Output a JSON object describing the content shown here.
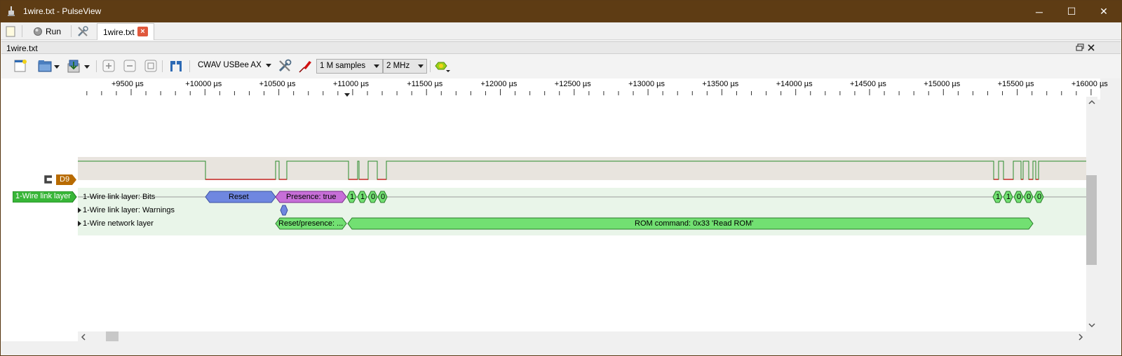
{
  "window": {
    "title": "1wire.txt - PulseView",
    "controls": [
      "─",
      "☐",
      "✕"
    ]
  },
  "tabs": {
    "new_icon": "document-icon",
    "run_label": "Run",
    "doc_tab_label": "1wire.txt",
    "close_glyph": "×"
  },
  "doc_bar": {
    "title": "1wire.txt"
  },
  "toolbar": {
    "device": "CWAV USBee AX",
    "samples": "1 M samples",
    "rate": "2 MHz"
  },
  "ruler": {
    "ticks": [
      "+9500 µs",
      "+10000 µs",
      "+10500 µs",
      "+11000 µs",
      "+11500 µs",
      "+12000 µs",
      "+12500 µs",
      "+13000 µs",
      "+13500 µs",
      "+14000 µs",
      "+14500 µs",
      "+15000 µs",
      "+15500 µs",
      "+16000 µs"
    ]
  },
  "channel": {
    "name": "D9"
  },
  "decoder": {
    "name": "1-Wire link layer",
    "rows": [
      "1-Wire link layer: Bits",
      "1-Wire link layer: Warnings",
      "1-Wire network layer"
    ],
    "annotations": {
      "reset": "Reset",
      "presence": "Presence: true",
      "bits_left": [
        "1",
        "1",
        "0",
        "0"
      ],
      "bits_right": [
        "1",
        "1",
        "0",
        "0",
        "0"
      ],
      "reset_presence": "Reset/presence: ...",
      "rom_command": "ROM command: 0x33 'Read ROM'"
    }
  },
  "colors": {
    "title_bar": "#5e3c14",
    "signal_line": "#2a8c2a",
    "signal_low": "#c00000",
    "trace_bg": "#e8e4de",
    "decoder_bg": "#e9f5e9",
    "reset_fill": "#6f87e0",
    "presence_fill": "#c76fd8",
    "bit_fill": "#72e072",
    "decoder_badge": "#38b638",
    "channel_badge": "#b86b00"
  }
}
